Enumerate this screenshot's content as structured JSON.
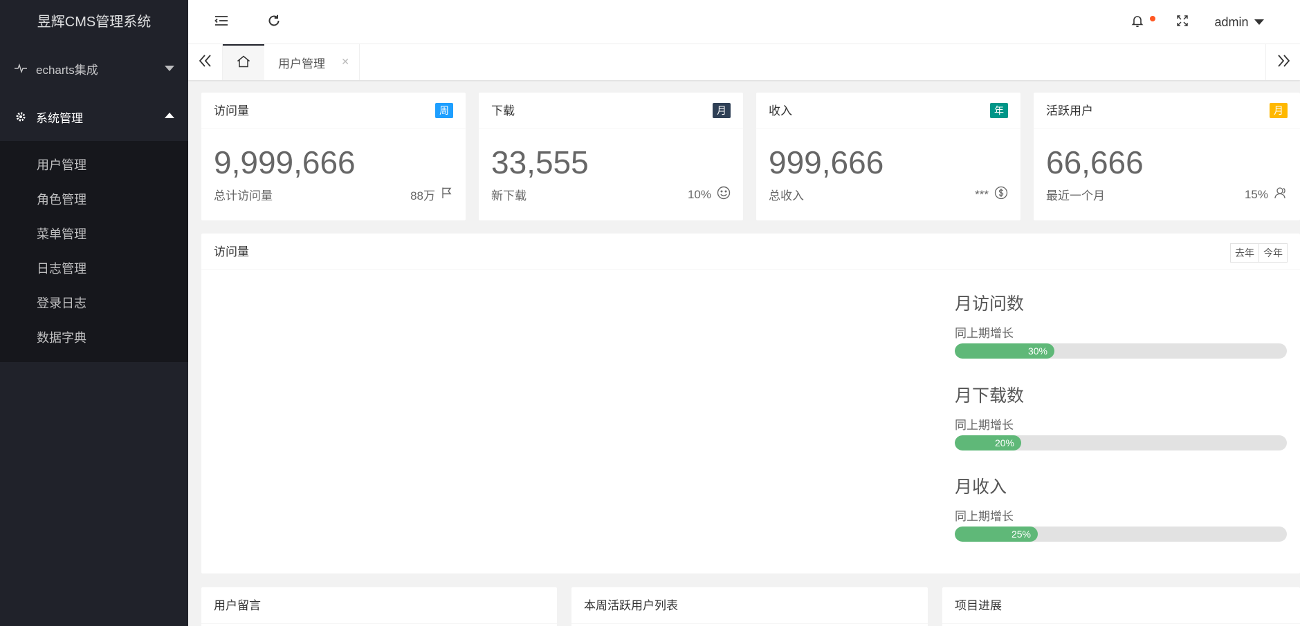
{
  "app": {
    "title": "昱辉CMS管理系统"
  },
  "sidebar": {
    "groups": [
      {
        "label": "echarts集成",
        "icon": "pulse-icon",
        "open": false
      },
      {
        "label": "系统管理",
        "icon": "gear-icon",
        "open": true
      }
    ],
    "subitems": [
      "用户管理",
      "角色管理",
      "菜单管理",
      "日志管理",
      "登录日志",
      "数据字典"
    ]
  },
  "header": {
    "user": "admin"
  },
  "tabs": {
    "current": "用户管理"
  },
  "stats": [
    {
      "title": "访问量",
      "badge": "周",
      "badge_color": "#1e9fff",
      "value": "9,999,666",
      "foot_left": "总计访问量",
      "foot_right": "88万",
      "icon": "flag-icon"
    },
    {
      "title": "下载",
      "badge": "月",
      "badge_color": "#2f4056",
      "value": "33,555",
      "foot_left": "新下载",
      "foot_right": "10%",
      "icon": "smile-icon"
    },
    {
      "title": "收入",
      "badge": "年",
      "badge_color": "#009688",
      "value": "999,666",
      "foot_left": "总收入",
      "foot_right": "***",
      "icon": "dollar-icon"
    },
    {
      "title": "活跃用户",
      "badge": "月",
      "badge_color": "#ffb800",
      "value": "66,666",
      "foot_left": "最近一个月",
      "foot_right": "15%",
      "icon": "user-icon"
    }
  ],
  "visits": {
    "title": "访问量",
    "buttons": [
      "去年",
      "今年"
    ],
    "progress": [
      {
        "title": "月访问数",
        "sub": "同上期增长",
        "percent": 30,
        "label": "30%"
      },
      {
        "title": "月下载数",
        "sub": "同上期增长",
        "percent": 20,
        "label": "20%"
      },
      {
        "title": "月收入",
        "sub": "同上期增长",
        "percent": 25,
        "label": "25%"
      }
    ]
  },
  "bottom_cards": [
    "用户留言",
    "本周活跃用户列表",
    "项目进展"
  ]
}
